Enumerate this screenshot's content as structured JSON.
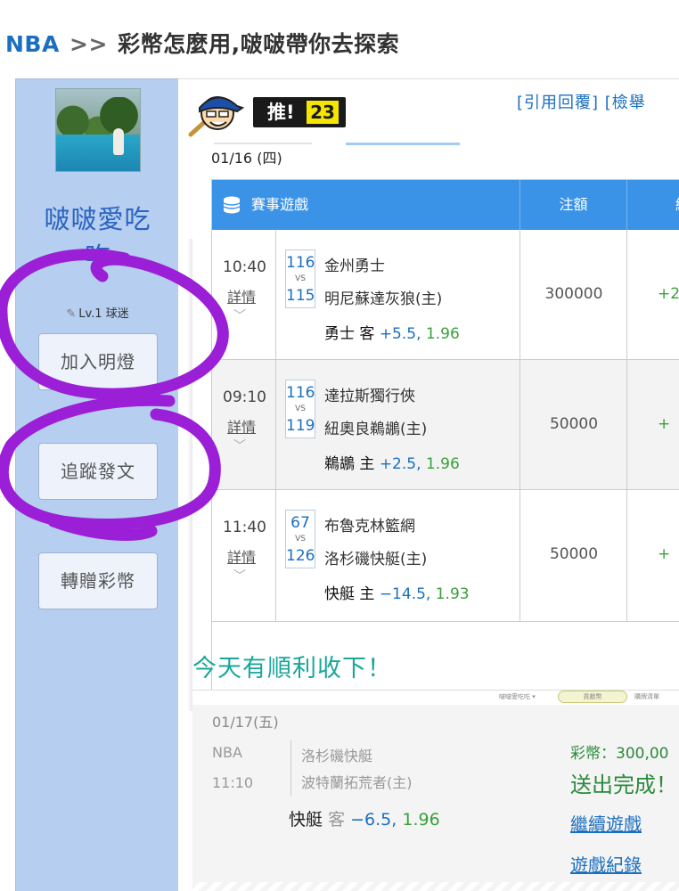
{
  "breadcrumb": {
    "section": "NBA",
    "separator": ">>",
    "title": "彩幣怎麼用,啵啵帶你去探索"
  },
  "user": {
    "name_line1": "啵啵愛吃",
    "name_line2": "吃",
    "level": "Lv.1 球迷",
    "buttons": {
      "light": "加入明燈",
      "follow": "追蹤發文",
      "gift": "轉贈彩幣"
    }
  },
  "post": {
    "push_label": "推!",
    "push_count": "23",
    "quote_reply": "[引用回覆]",
    "report": "[檢舉"
  },
  "games": {
    "date": "01/16 (四)",
    "headers": {
      "game": "賽事遊戲",
      "amount": "注額",
      "result": "結"
    },
    "rows": [
      {
        "time": "10:40",
        "detail": "詳情",
        "score_away": "116",
        "vs": "VS",
        "score_home": "115",
        "team_away": "金州勇士",
        "team_home": "明尼蘇達灰狼(主)",
        "pick_team": "勇士",
        "pick_side": "客",
        "pick_line": "+5.5",
        "pick_sep": ",",
        "pick_odds": "1.96",
        "amount": "300000",
        "result": "+2"
      },
      {
        "time": "09:10",
        "detail": "詳情",
        "score_away": "116",
        "vs": "VS",
        "score_home": "119",
        "team_away": "達拉斯獨行俠",
        "team_home": "紐奧良鵜鶘(主)",
        "pick_team": "鵜鶘",
        "pick_side": "主",
        "pick_line": "+2.5",
        "pick_sep": ",",
        "pick_odds": "1.96",
        "amount": "50000",
        "result": "+"
      },
      {
        "time": "11:40",
        "detail": "詳情",
        "score_away": "67",
        "vs": "VS",
        "score_home": "126",
        "team_away": "布魯克林籃網",
        "team_home": "洛杉磯快艇(主)",
        "pick_team": "快艇",
        "pick_side": "主",
        "pick_line": "−14.5",
        "pick_sep": ",",
        "pick_odds": "1.93",
        "amount": "50000",
        "result": "+"
      }
    ]
  },
  "headline": "今天有順利收下！",
  "ticket": {
    "top_user": "啵啵愛吃吃 ▾",
    "top_mid": "貢獻幣",
    "top_right": "購牌清單",
    "date": "01/17(五)",
    "league": "NBA",
    "time": "11:10",
    "team_away": "洛杉磯快艇",
    "team_home": "波特蘭拓荒者(主)",
    "pick_team": "快艇",
    "pick_side": "客",
    "pick_line": "−6.5",
    "pick_sep": ",",
    "pick_odds": "1.96",
    "coins": "彩幣：300,00",
    "sent": "送出完成！",
    "continue": "繼續遊戲",
    "records": "遊戲紀錄"
  },
  "colors": {
    "brand_blue": "#1b6fc0",
    "header_blue": "#3a93e6",
    "side_panel": "#b6cef0",
    "win_green": "#3aa03a",
    "headline_teal": "#1aa79a",
    "annotation_purple": "#9b1fd6"
  }
}
